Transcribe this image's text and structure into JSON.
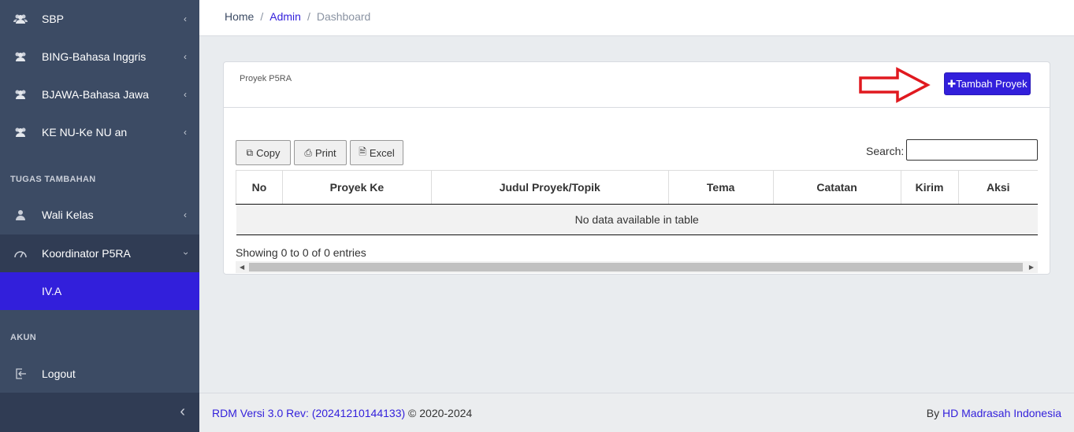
{
  "sidebar": {
    "items": [
      {
        "label": "SBP",
        "icon": "users-icon"
      },
      {
        "label": "BING-Bahasa Inggris",
        "icon": "users-icon"
      },
      {
        "label": "BJAWA-Bahasa Jawa",
        "icon": "users-icon"
      },
      {
        "label": "KE NU-Ke NU an",
        "icon": "users-icon"
      }
    ],
    "section_tugas": "TUGAS TAMBAHAN",
    "wali_kelas": "Wali Kelas",
    "koordinator": "Koordinator P5RA",
    "sub_active": "IV.A",
    "section_akun": "AKUN",
    "logout": "Logout"
  },
  "breadcrumb": {
    "home": "Home",
    "admin": "Admin",
    "current": "Dashboard",
    "sep": "/"
  },
  "card": {
    "title": "Proyek P5RA",
    "add_button": "Tambah Proyek"
  },
  "datatable": {
    "buttons": {
      "copy": "Copy",
      "print": "Print",
      "excel": "Excel"
    },
    "search_label": "Search:",
    "search_value": "",
    "columns": [
      "No",
      "Proyek Ke",
      "Judul Proyek/Topik",
      "Tema",
      "Catatan",
      "Kirim",
      "Aksi"
    ],
    "empty_text": "No data available in table",
    "info": "Showing 0 to 0 of 0 entries"
  },
  "footer": {
    "version_link": "RDM Versi 3.0 Rev: (20241210144133)",
    "copyright": " © 2020-2024",
    "by": "By ",
    "company": "HD Madrasah Indonesia"
  },
  "colors": {
    "sidebar": "#3c4b64",
    "active": "#321fdb",
    "primary": "#321fdb",
    "annotation_arrow": "#e0191f"
  }
}
